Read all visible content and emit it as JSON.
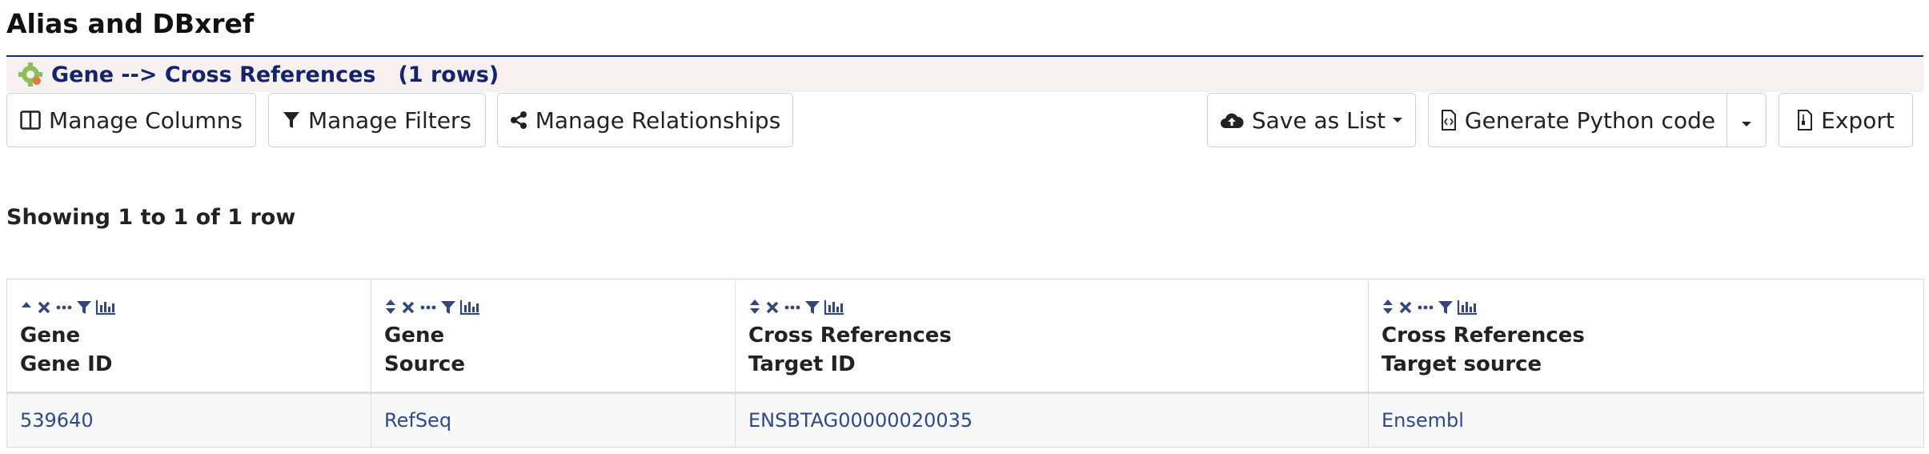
{
  "page": {
    "title": "Alias and DBxref"
  },
  "query": {
    "path_label": "Gene --> Cross References",
    "row_count_label": "(1 rows)",
    "icon": "gear-puzzle-icon"
  },
  "toolbar": {
    "manage_columns": "Manage Columns",
    "manage_filters": "Manage Filters",
    "manage_relationships": "Manage Relationships",
    "save_as_list": "Save as List",
    "generate_python": "Generate Python code",
    "export": "Export"
  },
  "summary": {
    "text": "Showing 1 to 1 of 1 row"
  },
  "table": {
    "columns": [
      {
        "line1": "Gene",
        "line2": "Gene ID",
        "sort": "asc"
      },
      {
        "line1": "Gene",
        "line2": "Source",
        "sort": "none"
      },
      {
        "line1": "Cross References",
        "line2": "Target ID",
        "sort": "none"
      },
      {
        "line1": "Cross References",
        "line2": "Target source",
        "sort": "none"
      }
    ],
    "rows": [
      [
        "539640",
        "RefSeq",
        "ENSBTAG00000020035",
        "Ensembl"
      ]
    ]
  },
  "colors": {
    "accent": "#14236b",
    "link": "#2e4a8a",
    "header_bg": "#f6f0ee",
    "icon": "#34467a"
  }
}
